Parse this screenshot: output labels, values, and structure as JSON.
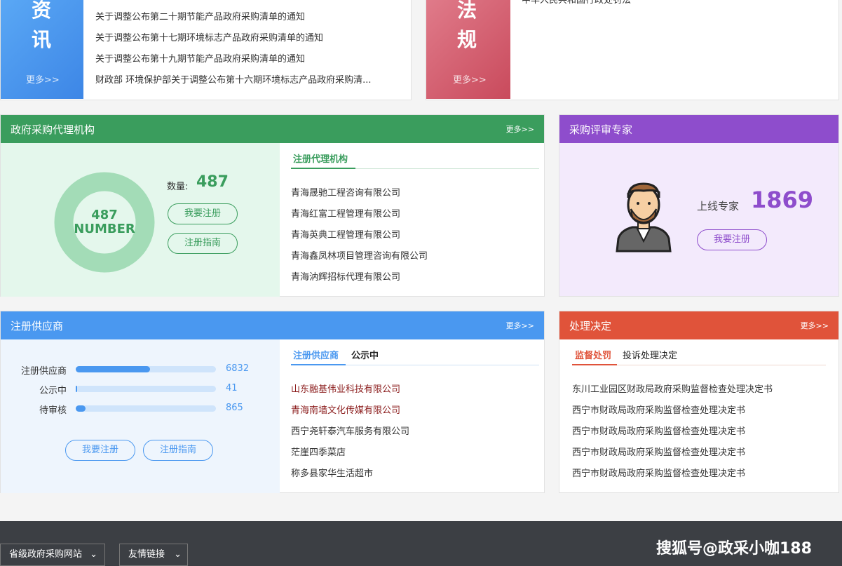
{
  "news": {
    "side_chars": [
      "资",
      "讯"
    ],
    "more": "更多>>",
    "items": [
      "关于调整公布第二十期节能产品政府采购清单的通知",
      "关于调整公布第十七期环境标志产品政府采购清单的通知",
      "关于调整公布第十九期节能产品政府采购清单的通知",
      "财政部 环境保护部关于调整公布第十六期环境标志产品政府采购清..."
    ]
  },
  "law": {
    "side_chars": [
      "法",
      "规"
    ],
    "more": "更多>>",
    "items": [
      "中华人民共和国行政处罚法"
    ]
  },
  "agency": {
    "title": "政府采购代理机构",
    "more": "更多>>",
    "donut_value": "487",
    "donut_label": "NUMBER",
    "count_label": "数量:",
    "count": "487",
    "register_btn": "我要注册",
    "guide_btn": "注册指南",
    "tab": "注册代理机构",
    "items": [
      "青海晟驰工程咨询有限公司",
      "青海红富工程管理有限公司",
      "青海英典工程管理有限公司",
      "青海鑫凤林项目管理咨询有限公司",
      "青海汭辉招标代理有限公司"
    ],
    "color": "#3a9d5d"
  },
  "expert": {
    "title": "采购评审专家",
    "online_label": "上线专家",
    "count": "1869",
    "register_btn": "我要注册",
    "color": "#8e4dcc"
  },
  "supplier": {
    "title": "注册供应商",
    "more": "更多>>",
    "stats": [
      {
        "label": "注册供应商",
        "value": "6832",
        "fraction": 0.53
      },
      {
        "label": "公示中",
        "value": "41",
        "fraction": 0.004
      },
      {
        "label": "待审核",
        "value": "865",
        "fraction": 0.07
      }
    ],
    "register_btn": "我要注册",
    "guide_btn": "注册指南",
    "tabs": [
      "注册供应商",
      "公示中"
    ],
    "items": [
      "山东融基伟业科技有限公司",
      "青海南墙文化传媒有限公司",
      "西宁尧轩泰汽车服务有限公司",
      "茫崖四季菜店",
      "称多县家华生活超市"
    ],
    "color": "#4a98f0"
  },
  "decision": {
    "title": "处理决定",
    "more": "更多>>",
    "tabs": [
      "监督处罚",
      "投诉处理决定"
    ],
    "items": [
      "东川工业园区财政局政府采购监督检查处理决定书",
      "西宁市财政局政府采购监督检查处理决定书",
      "西宁市财政局政府采购监督检查处理决定书",
      "西宁市财政局政府采购监督检查处理决定书",
      "西宁市财政局政府采购监督检查处理决定书"
    ],
    "color": "#e0533a"
  },
  "footer": {
    "dropdowns": [
      "省级政府采购网站",
      "友情链接"
    ],
    "watermark": "搜狐号@政采小咖188"
  }
}
